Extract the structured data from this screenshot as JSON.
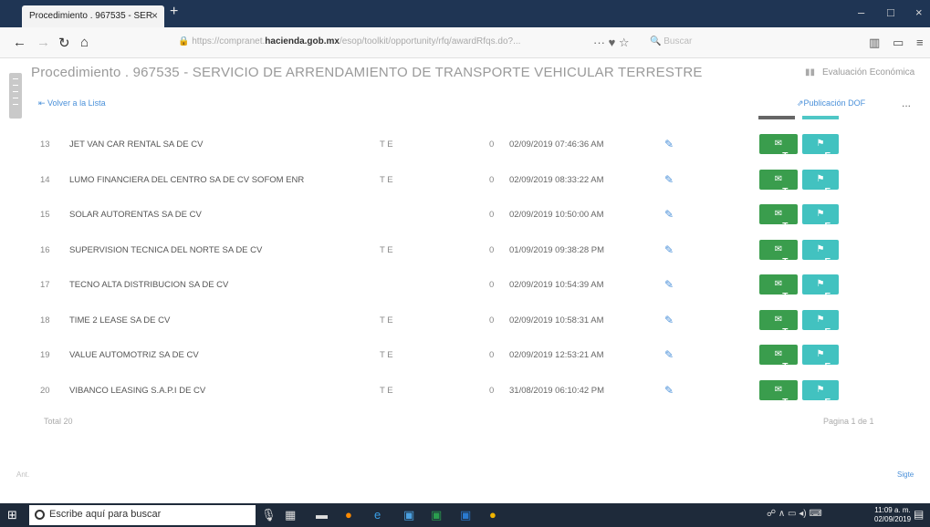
{
  "browser": {
    "tab_title": "Procedimiento . 967535 - SER",
    "tab_close": "×",
    "new_tab": "+",
    "url_prefix": "https://compranet.",
    "url_domain": "hacienda.gob.mx",
    "url_suffix": "/esop/toolkit/opportunity/rfq/awardRfqs.do?...",
    "search_placeholder": "Buscar",
    "win_min": "–",
    "win_max": "□",
    "win_close": "×"
  },
  "page": {
    "title": "Procedimiento . 967535 - SERVICIO DE ARRENDAMIENTO DE TRANSPORTE VEHICULAR TERRESTRE",
    "eval_label": "Evaluación Económica",
    "back_label": "Volver a la Lista",
    "dof_label": "Publicación DOF",
    "more_label": "...",
    "btn_t": "T",
    "btn_e": "E",
    "total": "Total 20",
    "pagination": "Pagina 1 de 1",
    "prev": "Ant.",
    "next": "Sigte"
  },
  "rows": [
    {
      "num": "13",
      "name": "JET VAN CAR RENTAL SA DE CV",
      "te": "T E",
      "zero": "0",
      "date": "02/09/2019 07:46:36 AM"
    },
    {
      "num": "14",
      "name": "LUMO FINANCIERA DEL CENTRO SA DE CV SOFOM ENR",
      "te": "T E",
      "zero": "0",
      "date": "02/09/2019 08:33:22 AM"
    },
    {
      "num": "15",
      "name": "SOLAR AUTORENTAS SA DE CV",
      "te": "",
      "zero": "0",
      "date": "02/09/2019 10:50:00 AM"
    },
    {
      "num": "16",
      "name": "SUPERVISION TECNICA DEL NORTE SA DE CV",
      "te": "T E",
      "zero": "0",
      "date": "01/09/2019 09:38:28 PM"
    },
    {
      "num": "17",
      "name": "TECNO ALTA DISTRIBUCION SA DE CV",
      "te": "",
      "zero": "0",
      "date": "02/09/2019 10:54:39 AM"
    },
    {
      "num": "18",
      "name": "TIME 2 LEASE SA DE CV",
      "te": "T E",
      "zero": "0",
      "date": "02/09/2019 10:58:31 AM"
    },
    {
      "num": "19",
      "name": "VALUE AUTOMOTRIZ SA DE CV",
      "te": "T E",
      "zero": "0",
      "date": "02/09/2019 12:53:21 AM"
    },
    {
      "num": "20",
      "name": "VIBANCO LEASING S.A.P.I DE CV",
      "te": "T E",
      "zero": "0",
      "date": "31/08/2019 06:10:42 PM"
    }
  ],
  "taskbar": {
    "search_text": "Escribe aquí para buscar",
    "time": "11:09 a. m.",
    "date": "02/09/2019"
  }
}
